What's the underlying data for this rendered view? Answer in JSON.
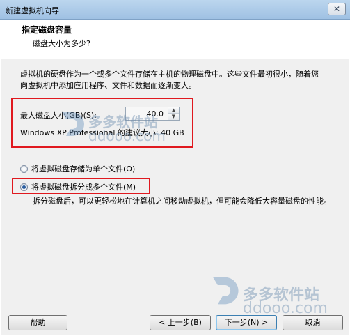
{
  "window": {
    "title": "新建虚拟机向导",
    "close_glyph": "✕"
  },
  "header": {
    "title": "指定磁盘容量",
    "subtitle": "磁盘大小为多少?"
  },
  "description": "虚拟机的硬盘作为一个或多个文件存储在主机的物理磁盘中。这些文件最初很小，随着您向虚拟机中添加应用程序、文件和数据而逐渐变大。",
  "disk_size": {
    "label": "最大磁盘大小(GB)(S):",
    "value": "40.0",
    "recommendation": "Windows XP Professional 的建议大小: 40 GB"
  },
  "storage_options": [
    {
      "label": "将虚拟磁盘存储为单个文件(O)",
      "selected": false
    },
    {
      "label": "将虚拟磁盘拆分成多个文件(M)",
      "selected": true
    }
  ],
  "split_description": "拆分磁盘后，可以更轻松地在计算机之间移动虚拟机，但可能会降低大容量磁盘的性能。",
  "watermark": {
    "brand": "多多软件站",
    "domain": "ddooo.com"
  },
  "buttons": {
    "help": "帮助",
    "back": "< 上一步(B)",
    "next": "下一步(N) >",
    "cancel": "取消"
  },
  "colors": {
    "highlight_border": "#e0191f",
    "accent": "#2a5d9f"
  }
}
